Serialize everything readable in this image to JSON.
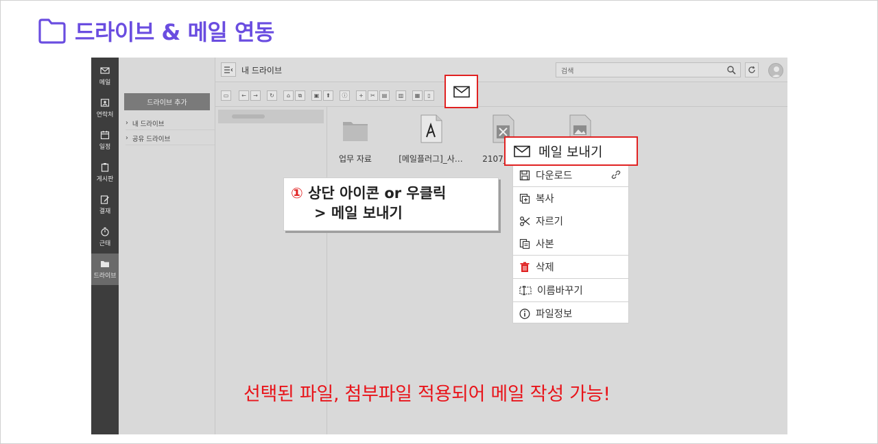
{
  "slide": {
    "title": "드라이브 & 메일 연동",
    "accent_color": "#6a4de0",
    "title_icon": "folder-icon"
  },
  "left_nav": {
    "items": [
      {
        "label": "메일",
        "icon": "mail-icon"
      },
      {
        "label": "연락처",
        "icon": "contact-icon"
      },
      {
        "label": "일정",
        "icon": "calendar-icon"
      },
      {
        "label": "게시판",
        "icon": "clipboard-icon"
      },
      {
        "label": "결재",
        "icon": "edit-icon"
      },
      {
        "label": "근태",
        "icon": "timer-icon"
      },
      {
        "label": "드라이브",
        "icon": "folder-open-icon",
        "active": true
      }
    ]
  },
  "sidebar": {
    "add_button": "드라이브 추가",
    "tree": [
      {
        "label": "내 드라이브"
      },
      {
        "label": "공유 드라이브"
      }
    ]
  },
  "topbar": {
    "title": "내 드라이브",
    "search_placeholder": "검색"
  },
  "files": [
    {
      "name": "업무 자료",
      "type": "folder"
    },
    {
      "name": "[메일플러그]_사…",
      "type": "pdf"
    },
    {
      "name": "2107_업…",
      "type": "xls"
    },
    {
      "name": "",
      "type": "image"
    }
  ],
  "context_menu": {
    "send_mail": "메일 보내기",
    "items": [
      {
        "label": "다운로드",
        "icon": "save-icon"
      },
      {
        "label": "복사",
        "icon": "copy-plus-icon"
      },
      {
        "label": "자르기",
        "icon": "scissors-icon"
      },
      {
        "label": "사본",
        "icon": "duplicate-icon"
      },
      {
        "label": "삭제",
        "icon": "trash-icon"
      },
      {
        "label": "이름바꾸기",
        "icon": "rename-icon"
      },
      {
        "label": "파일정보",
        "icon": "info-icon"
      }
    ]
  },
  "callout": {
    "number": "①",
    "line1": "상단 아이콘 or 우클릭",
    "line2": "> 메일  보내기"
  },
  "note": "선택된 파일, 첨부파일 적용되어 메일 작성 가능!",
  "colors": {
    "highlight_red": "#e02020",
    "note_red": "#e8141a",
    "nav_bg": "#3d3d3d"
  }
}
